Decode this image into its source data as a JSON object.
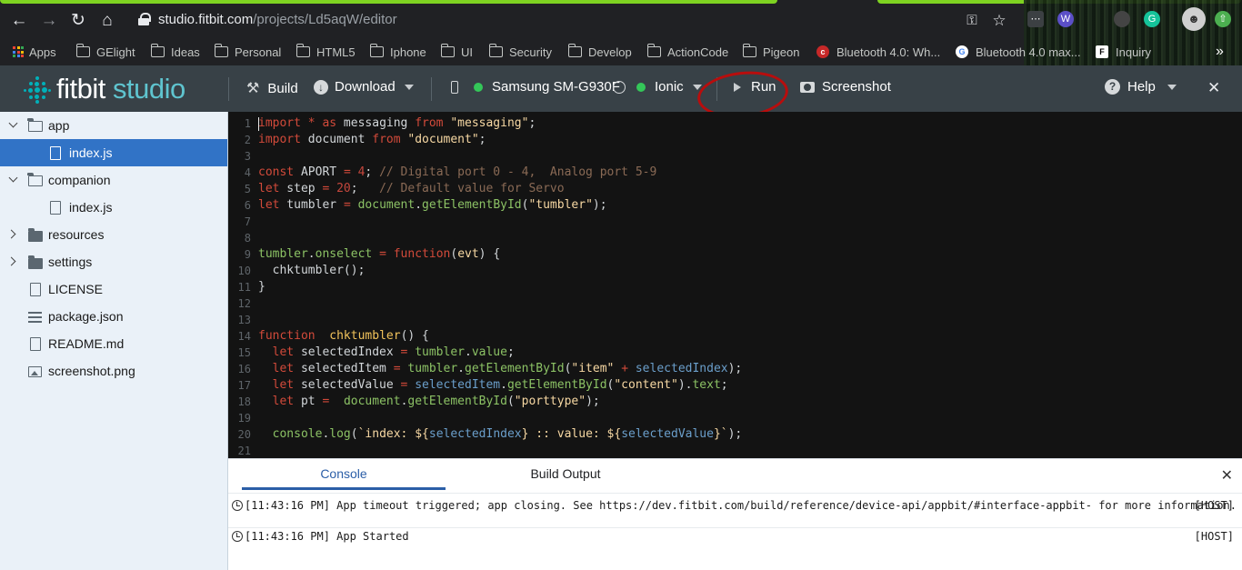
{
  "browser": {
    "url_host": "studio.fitbit.com",
    "url_path": "/projects/Ld5aqW/editor",
    "bookmarks": [
      "Apps",
      "GElight",
      "Ideas",
      "Personal",
      "HTML5",
      "Iphone",
      "UI",
      "Security",
      "Develop",
      "ActionCode",
      "Pigeon",
      "Bluetooth 4.0: Wh...",
      "Bluetooth 4.0 max...",
      "Inquiry"
    ],
    "bookmarks_more": "»"
  },
  "toolbar": {
    "brand_main": "fitbit",
    "brand_sub": "studio",
    "build": "Build",
    "download": "Download",
    "device_phone": "Samsung SM-G930F",
    "device_watch": "Ionic",
    "run": "Run",
    "screenshot": "Screenshot",
    "help": "Help",
    "close": "✕",
    "accent": "#00b0b9",
    "status_color": "#34c759",
    "annotation_color": "#b80d0d"
  },
  "sidebar": {
    "items": [
      {
        "label": "app",
        "icon": "folder-open-icon",
        "expanded": true
      },
      {
        "label": "index.js",
        "icon": "file-icon",
        "selected": true
      },
      {
        "label": "companion",
        "icon": "folder-open-icon",
        "expanded": true
      },
      {
        "label": "index.js",
        "icon": "file-icon"
      },
      {
        "label": "resources",
        "icon": "folder-icon",
        "expanded": false
      },
      {
        "label": "settings",
        "icon": "folder-icon",
        "expanded": false
      },
      {
        "label": "LICENSE",
        "icon": "file-icon"
      },
      {
        "label": "package.json",
        "icon": "list-icon"
      },
      {
        "label": "README.md",
        "icon": "file-icon"
      },
      {
        "label": "screenshot.png",
        "icon": "image-icon"
      }
    ]
  },
  "editor": {
    "line_numbers": [
      "1",
      "2",
      "3",
      "4",
      "5",
      "6",
      "7",
      "8",
      "9",
      "10",
      "11",
      "12",
      "13",
      "14",
      "15",
      "16",
      "17",
      "18",
      "19",
      "20",
      "21"
    ],
    "lines": [
      "import * as messaging from \"messaging\";",
      "import document from \"document\";",
      "",
      "const APORT = 4; // Digital port 0 - 4,  Analog port 5-9",
      "let step = 20;   // Default value for Servo",
      "let tumbler = document.getElementById(\"tumbler\");",
      "",
      "",
      "tumbler.onselect = function(evt) {",
      "  chktumbler();",
      "}",
      "",
      "",
      "function  chktumbler() {",
      "  let selectedIndex = tumbler.value;",
      "  let selectedItem = tumbler.getElementById(\"item\" + selectedIndex);",
      "  let selectedValue = selectedItem.getElementById(\"content\").text;",
      "  let pt =  document.getElementById(\"porttype\");",
      "",
      "  console.log(`index: ${selectedIndex} :: value: ${selectedValue}`);",
      ""
    ]
  },
  "console": {
    "tab_console": "Console",
    "tab_build": "Build Output",
    "close": "✕",
    "logs": [
      {
        "time": "[11:43:16 PM]",
        "message": "App timeout triggered; app closing. See https://dev.fitbit.com/build/reference/device-api/appbit/#interface-appbit- for more information.",
        "source": "[HOST]"
      },
      {
        "time": "[11:43:16 PM]",
        "message": "App Started",
        "source": "[HOST]"
      }
    ]
  }
}
